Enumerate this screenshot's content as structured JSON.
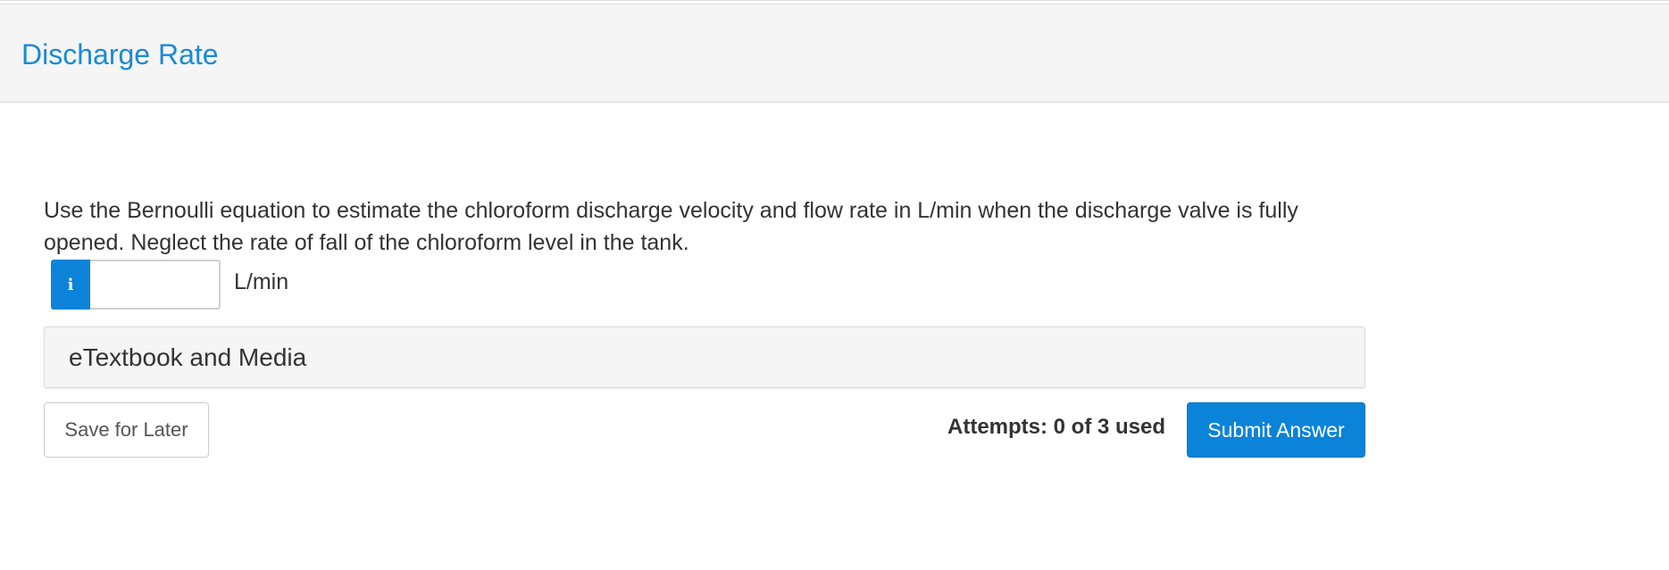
{
  "header": {
    "title": "Discharge Rate"
  },
  "question": {
    "text": "Use the Bernoulli equation to estimate the chloroform discharge velocity and flow rate in L/min when the discharge valve is fully opened. Neglect the rate of fall of the chloroform level in the tank."
  },
  "answer": {
    "info_icon": "info-icon",
    "info_glyph": "i",
    "value": "",
    "placeholder": "",
    "unit": "L/min"
  },
  "media": {
    "label": "eTextbook and Media"
  },
  "footer": {
    "save_label": "Save for Later",
    "attempts_text": "Attempts: 0 of 3 used",
    "submit_label": "Submit Answer"
  },
  "colors": {
    "accent": "#0b83d9",
    "title_link": "#1a8ad4",
    "header_bg": "#f5f5f5"
  }
}
